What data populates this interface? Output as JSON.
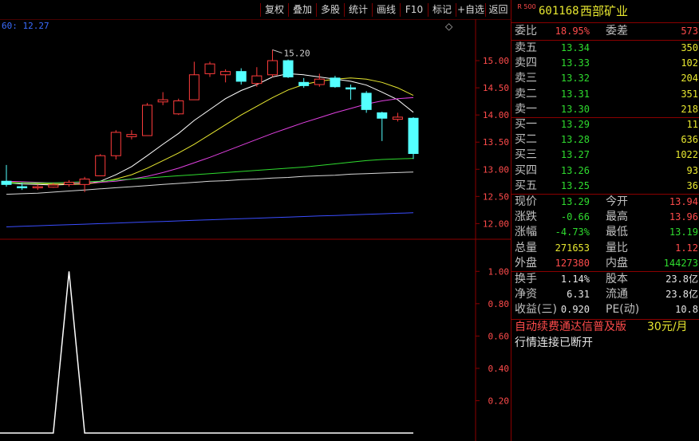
{
  "toolbar": {
    "buttons": [
      "复权",
      "叠加",
      "多股",
      "统计",
      "画线",
      "F10",
      "标记",
      "+自选",
      "返回"
    ]
  },
  "chart": {
    "price_axis": [
      "15.00",
      "14.50",
      "14.00",
      "13.50",
      "13.00",
      "12.50",
      "12.00"
    ],
    "indicator_axis": [
      "1.00",
      "0.80",
      "0.60",
      "0.40",
      "0.20"
    ],
    "corner_text": "60: 12.27",
    "peak_label": "15.20",
    "diamond": "◇"
  },
  "chart_data": [
    {
      "type": "candlestick",
      "ylim": [
        11.8,
        15.5
      ],
      "candles": [
        {
          "o": 12.78,
          "c": 12.72,
          "h": 13.08,
          "l": 12.68
        },
        {
          "o": 12.68,
          "c": 12.66,
          "h": 12.75,
          "l": 12.62
        },
        {
          "o": 12.66,
          "c": 12.68,
          "h": 12.72,
          "l": 12.62
        },
        {
          "o": 12.67,
          "c": 12.71,
          "h": 12.75,
          "l": 12.66
        },
        {
          "o": 12.72,
          "c": 12.76,
          "h": 12.8,
          "l": 12.68
        },
        {
          "o": 12.72,
          "c": 12.82,
          "h": 12.86,
          "l": 12.58
        },
        {
          "o": 12.88,
          "c": 13.25,
          "h": 13.28,
          "l": 12.88
        },
        {
          "o": 13.25,
          "c": 13.68,
          "h": 13.72,
          "l": 13.18
        },
        {
          "o": 13.6,
          "c": 13.64,
          "h": 13.72,
          "l": 13.55
        },
        {
          "o": 13.62,
          "c": 14.18,
          "h": 14.22,
          "l": 13.62
        },
        {
          "o": 14.24,
          "c": 14.28,
          "h": 14.42,
          "l": 14.18
        },
        {
          "o": 14.02,
          "c": 14.26,
          "h": 14.3,
          "l": 14.0
        },
        {
          "o": 14.28,
          "c": 14.74,
          "h": 14.98,
          "l": 14.28
        },
        {
          "o": 14.76,
          "c": 14.94,
          "h": 14.98,
          "l": 14.7
        },
        {
          "o": 14.74,
          "c": 14.8,
          "h": 14.84,
          "l": 14.6
        },
        {
          "o": 14.8,
          "c": 14.62,
          "h": 14.86,
          "l": 14.56
        },
        {
          "o": 14.58,
          "c": 14.72,
          "h": 14.88,
          "l": 14.52
        },
        {
          "o": 14.74,
          "c": 15.0,
          "h": 15.2,
          "l": 14.7
        },
        {
          "o": 15.0,
          "c": 14.7,
          "h": 15.02,
          "l": 14.68
        },
        {
          "o": 14.6,
          "c": 14.54,
          "h": 14.68,
          "l": 14.5
        },
        {
          "o": 14.56,
          "c": 14.66,
          "h": 14.76,
          "l": 14.52
        },
        {
          "o": 14.68,
          "c": 14.52,
          "h": 14.72,
          "l": 14.5
        },
        {
          "o": 14.5,
          "c": 14.48,
          "h": 14.56,
          "l": 14.28
        },
        {
          "o": 14.4,
          "c": 14.1,
          "h": 14.44,
          "l": 14.04
        },
        {
          "o": 14.04,
          "c": 13.94,
          "h": 14.06,
          "l": 13.52
        },
        {
          "o": 13.92,
          "c": 13.96,
          "h": 14.04,
          "l": 13.88
        },
        {
          "o": 13.94,
          "c": 13.29,
          "h": 13.96,
          "l": 13.19
        }
      ],
      "ma_lines": [
        {
          "color": "#ffffff",
          "values": [
            12.75,
            12.73,
            12.72,
            12.71,
            12.72,
            12.73,
            12.78,
            12.9,
            13.05,
            13.25,
            13.46,
            13.66,
            13.9,
            14.1,
            14.3,
            14.45,
            14.56,
            14.7,
            14.76,
            14.74,
            14.7,
            14.66,
            14.62,
            14.55,
            14.42,
            14.28,
            14.05
          ]
        },
        {
          "color": "#e8e830",
          "values": [
            12.76,
            12.75,
            12.74,
            12.73,
            12.73,
            12.73,
            12.76,
            12.82,
            12.9,
            13.02,
            13.16,
            13.3,
            13.46,
            13.64,
            13.82,
            14.0,
            14.16,
            14.32,
            14.46,
            14.56,
            14.62,
            14.66,
            14.68,
            14.66,
            14.6,
            14.5,
            14.36
          ]
        },
        {
          "color": "#e040e0",
          "values": [
            12.78,
            12.77,
            12.76,
            12.75,
            12.75,
            12.75,
            12.76,
            12.78,
            12.82,
            12.87,
            12.94,
            13.02,
            13.12,
            13.22,
            13.33,
            13.44,
            13.55,
            13.66,
            13.76,
            13.86,
            13.95,
            14.04,
            14.12,
            14.2,
            14.26,
            14.3,
            14.32
          ]
        },
        {
          "color": "#2fdc2f",
          "values": [
            12.74,
            12.75,
            12.75,
            12.75,
            12.76,
            12.77,
            12.78,
            12.8,
            12.82,
            12.84,
            12.86,
            12.88,
            12.9,
            12.92,
            12.94,
            12.96,
            12.98,
            13.0,
            13.02,
            13.04,
            13.07,
            13.1,
            13.13,
            13.16,
            13.18,
            13.19,
            13.2
          ]
        },
        {
          "color": "#d8d8d8",
          "values": [
            12.54,
            12.55,
            12.56,
            12.58,
            12.6,
            12.62,
            12.64,
            12.66,
            12.68,
            12.7,
            12.72,
            12.74,
            12.76,
            12.78,
            12.79,
            12.81,
            12.82,
            12.84,
            12.85,
            12.87,
            12.88,
            12.89,
            12.91,
            12.92,
            12.93,
            12.94,
            12.95
          ]
        },
        {
          "color": "#3a4dff",
          "values": [
            11.94,
            11.95,
            11.96,
            11.97,
            11.98,
            11.99,
            12.0,
            12.01,
            12.02,
            12.03,
            12.04,
            12.05,
            12.06,
            12.07,
            12.08,
            12.09,
            12.1,
            12.11,
            12.12,
            12.13,
            12.14,
            12.15,
            12.16,
            12.17,
            12.18,
            12.19,
            12.2
          ]
        }
      ]
    },
    {
      "type": "line",
      "ylim": [
        0,
        1.1
      ],
      "values": [
        0,
        0,
        0,
        0,
        1,
        0,
        0,
        0,
        0,
        0,
        0,
        0,
        0,
        0,
        0,
        0,
        0,
        0,
        0,
        0,
        0,
        0,
        0,
        0,
        0,
        0,
        0
      ]
    }
  ],
  "quote": {
    "index_badge": "R 500",
    "code": "601168",
    "name": "西部矿业",
    "weibi_label": "委比",
    "weibi": "18.95%",
    "weicha_label": "委差",
    "weicha": "573",
    "sell": [
      {
        "label": "卖五",
        "price": "13.34",
        "vol": "350"
      },
      {
        "label": "卖四",
        "price": "13.33",
        "vol": "102"
      },
      {
        "label": "卖三",
        "price": "13.32",
        "vol": "204"
      },
      {
        "label": "卖二",
        "price": "13.31",
        "vol": "351"
      },
      {
        "label": "卖一",
        "price": "13.30",
        "vol": "218"
      }
    ],
    "buy": [
      {
        "label": "买一",
        "price": "13.29",
        "vol": "11"
      },
      {
        "label": "买二",
        "price": "13.28",
        "vol": "636"
      },
      {
        "label": "买三",
        "price": "13.27",
        "vol": "1022"
      },
      {
        "label": "买四",
        "price": "13.26",
        "vol": "93"
      },
      {
        "label": "买五",
        "price": "13.25",
        "vol": "36"
      }
    ],
    "stats": [
      {
        "l1": "现价",
        "v1": "13.29",
        "c1": "green",
        "l2": "今开",
        "v2": "13.94",
        "c2": "red"
      },
      {
        "l1": "涨跌",
        "v1": "-0.66",
        "c1": "green",
        "l2": "最高",
        "v2": "13.96",
        "c2": "red"
      },
      {
        "l1": "涨幅",
        "v1": "-4.73%",
        "c1": "green",
        "l2": "最低",
        "v2": "13.19",
        "c2": "green"
      },
      {
        "l1": "总量",
        "v1": "271653",
        "c1": "yellow",
        "l2": "量比",
        "v2": "1.12",
        "c2": "red"
      },
      {
        "l1": "外盘",
        "v1": "127380",
        "c1": "red",
        "l2": "内盘",
        "v2": "144273",
        "c2": "green"
      }
    ],
    "finance": [
      {
        "l1": "换手",
        "v1": "1.14%",
        "l2": "股本",
        "v2": "23.8亿"
      },
      {
        "l1": "净资",
        "v1": "6.31",
        "l2": "流通",
        "v2": "23.8亿"
      },
      {
        "l1": "收益(三)",
        "v1": "0.920",
        "l2": "PE(动)",
        "v2": "10.8"
      }
    ],
    "promo_text": "自动续费通达信普及版",
    "promo_price": "30元/月",
    "status": "行情连接已断开"
  }
}
